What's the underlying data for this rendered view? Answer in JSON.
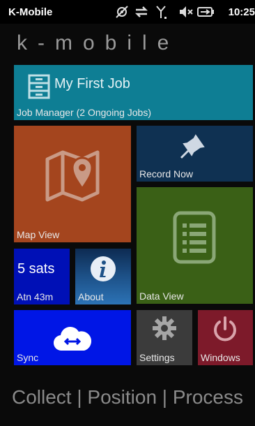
{
  "statusbar": {
    "app_title": "K-Mobile",
    "clock": "10:25",
    "icons": [
      "gps-off-icon",
      "data-transfer-icon",
      "signal-icon",
      "speaker-muted-icon",
      "battery-charging-icon"
    ]
  },
  "brand": "k-mobile",
  "tiles": {
    "job": {
      "title": "My First Job",
      "label": "Job Manager (2 Ongoing Jobs)",
      "icon": "filing-cabinet-icon"
    },
    "map": {
      "label": "Map View",
      "icon": "map-pin-icon"
    },
    "record": {
      "label": "Record Now",
      "icon": "pushpin-icon"
    },
    "dataview": {
      "label": "Data View",
      "icon": "list-document-icon"
    },
    "sats": {
      "count": "5 sats",
      "label": "Atn 43m"
    },
    "about": {
      "label": "About",
      "icon": "info-icon"
    },
    "sync": {
      "label": "Sync",
      "icon": "cloud-sync-icon"
    },
    "settings": {
      "label": "Settings",
      "icon": "gear-icon"
    },
    "windows": {
      "label": "Windows",
      "icon": "power-icon"
    }
  },
  "tagline": "Collect | Position | Process",
  "colors": {
    "job": "#0e7e94",
    "map": "#a4451e",
    "record": "#0f3152",
    "dataview": "#3a6016",
    "sats": "#0010b6",
    "sync": "#0016e6",
    "settings": "#3b3b3b",
    "windows": "#7d1a2a"
  }
}
